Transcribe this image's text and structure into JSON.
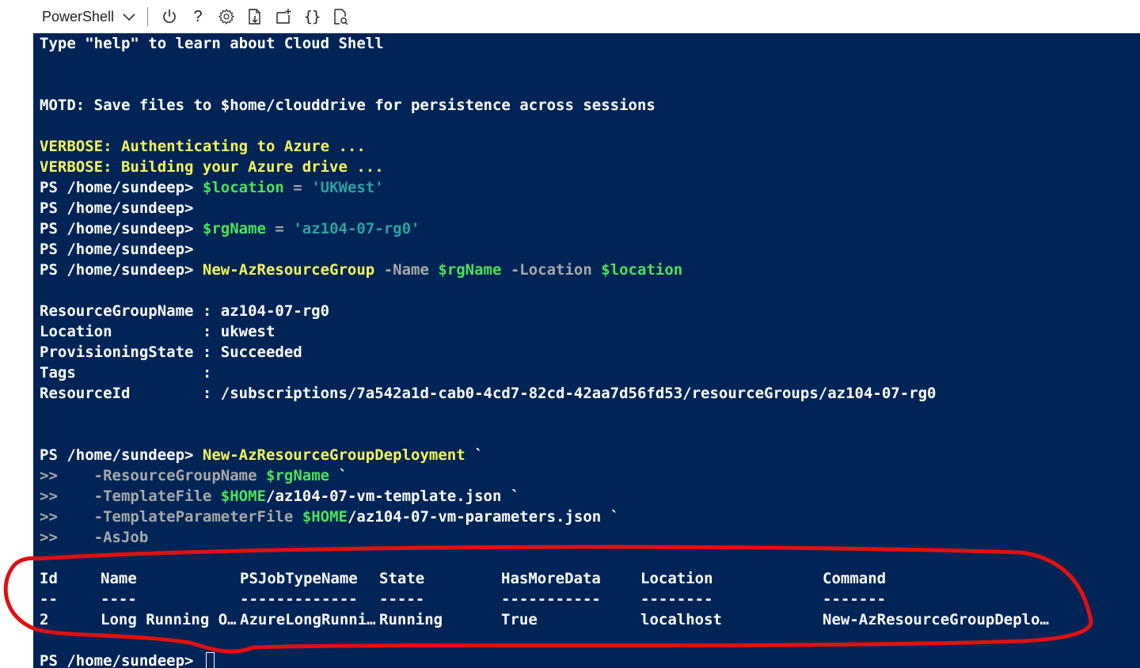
{
  "toolbar": {
    "shell_label": "PowerShell",
    "icons": [
      "power-icon",
      "help-icon",
      "gear-icon",
      "upload-download-icon",
      "new-session-icon",
      "editor-braces-icon",
      "web-preview-icon"
    ],
    "help_glyph": "?",
    "braces_glyph": "{}"
  },
  "terminal": {
    "background": "#012456",
    "intro": "Type \"help\" to learn about Cloud Shell",
    "motd": "MOTD: Save files to $home/clouddrive for persistence across sessions",
    "verbose1": "VERBOSE: Authenticating to Azure ...",
    "verbose2": "VERBOSE: Building your Azure drive ...",
    "prompt": "PS /home/sundeep> ",
    "cmd1_var": "$location",
    "cmd1_eq": " = ",
    "cmd1_str": "'UKWest'",
    "cmd2_var": "$rgName",
    "cmd2_eq": " = ",
    "cmd2_str": "'az104-07-rg0'",
    "cmd3_name": "New-AzResourceGroup",
    "cmd3_p1": " -Name ",
    "cmd3_v1": "$rgName",
    "cmd3_p2": " -Location ",
    "cmd3_v2": "$location",
    "rg_output": [
      {
        "key": "ResourceGroupName : ",
        "value": "az104-07-rg0"
      },
      {
        "key": "Location          : ",
        "value": "ukwest"
      },
      {
        "key": "ProvisioningState : ",
        "value": "Succeeded"
      },
      {
        "key": "Tags              : ",
        "value": ""
      },
      {
        "key": "ResourceId        : ",
        "value": "/subscriptions/7a542a1d-cab0-4cd7-82cd-42aa7d56fd53/resourceGroups/az104-07-rg0"
      }
    ],
    "deploy_cmd": "New-AzResourceGroupDeployment",
    "backtick": " `",
    "cont": ">>",
    "cont1_param": "    -ResourceGroupName ",
    "cont1_var": "$rgName",
    "cont2_param": "    -TemplateFile ",
    "cont2_var": "$HOME",
    "cont2_path": "/az104-07-vm-template.json",
    "cont3_param": "    -TemplateParameterFile ",
    "cont3_var": "$HOME",
    "cont3_path": "/az104-07-vm-parameters.json",
    "cont4_param": "    -AsJob",
    "jobs_table": {
      "headers": [
        "Id",
        "Name",
        "PSJobTypeName",
        "State",
        "HasMoreData",
        "Location",
        "Command"
      ],
      "underlines": [
        "--",
        "----",
        "-------------",
        "-----",
        "-----------",
        "--------",
        "-------"
      ],
      "row": [
        "2",
        "Long Running O…",
        "AzureLongRunni…",
        "Running",
        "True",
        "localhost",
        "New-AzResourceGroupDeplo…"
      ]
    },
    "final_prompt": "PS /home/sundeep> "
  },
  "annotation": {
    "color": "#e01010"
  }
}
